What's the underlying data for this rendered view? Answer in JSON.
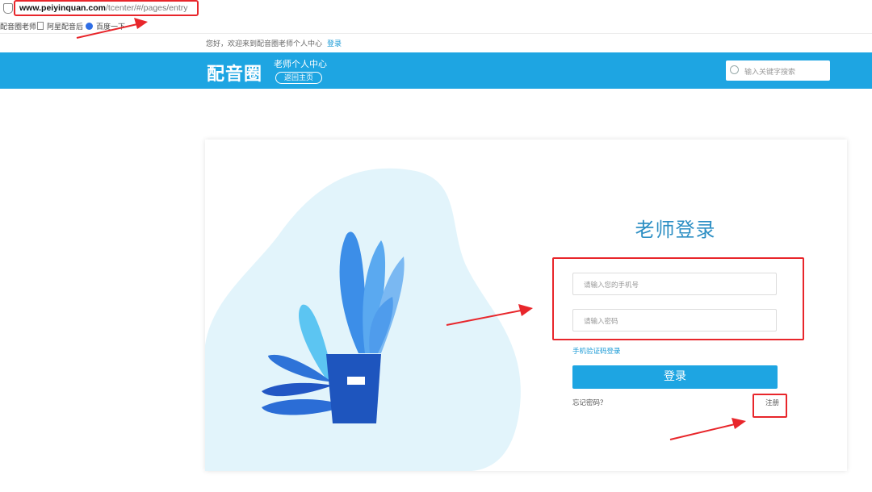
{
  "browser": {
    "url_host": "www.peiyinquan.com",
    "url_path": "/tcenter/#/pages/entry",
    "bookmarks": [
      "配音圈老师",
      "阿星配音后",
      "百度一下"
    ]
  },
  "site": {
    "welcome_text": "您好，欢迎来到配音圈老师个人中心",
    "welcome_login": "登录",
    "logo_text": "配音圈",
    "center_title": "老师个人中心",
    "back_home": "返回主页",
    "search_placeholder": "输入关键字搜索"
  },
  "login": {
    "title": "老师登录",
    "phone_placeholder": "请输入您的手机号",
    "password_placeholder": "请输入密码",
    "sms_login": "手机验证码登录",
    "submit": "登录",
    "forgot": "忘记密码？",
    "register": "注册"
  },
  "colors": {
    "brand_blue": "#1ea5e2",
    "title_blue": "#2d8fc4",
    "annotation_red": "#e8262b"
  }
}
